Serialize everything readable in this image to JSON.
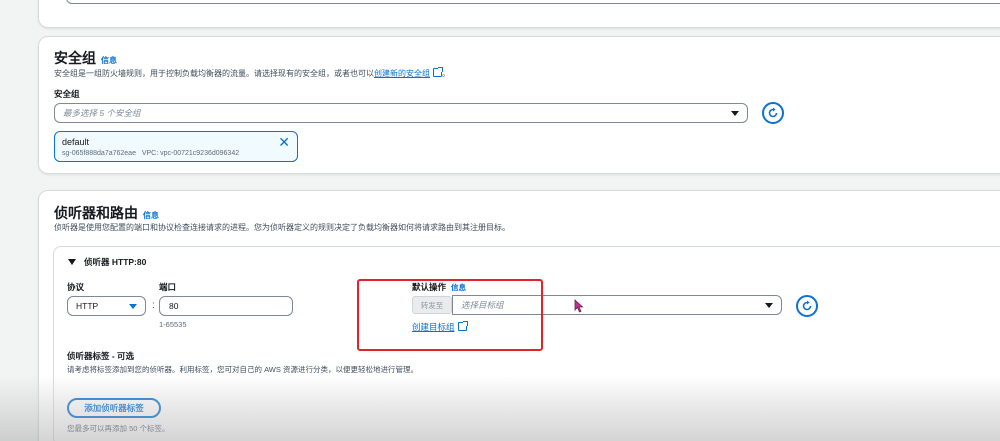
{
  "security_group": {
    "title": "安全组",
    "info": "信息",
    "description": "安全组是一组防火墙规则，用于控制负载均衡器的流量。请选择现有的安全组，或者也可以",
    "create_link": "创建新的安全组",
    "description_end": "。",
    "field_label": "安全组",
    "select_placeholder": "最多选择 5 个安全组",
    "selected": {
      "name": "default",
      "id": "sg-065f888da7a762eae",
      "vpc": "VPC: vpc-00721c9236d096342"
    }
  },
  "listeners": {
    "title": "侦听器和路由",
    "info": "信息",
    "description": "侦听器是使用您配置的端口和协议检查连接请求的进程。您为侦听器定义的规则决定了负载均衡器如何将请求路由到其注册目标。",
    "listener_header": "侦听器 HTTP:80",
    "protocol_label": "协议",
    "protocol_value": "HTTP",
    "colon": ":",
    "port_label": "端口",
    "port_value": "80",
    "port_hint": "1-65535",
    "default_action_label": "默认操作",
    "default_action_info": "信息",
    "forward_to": "转发至",
    "target_placeholder": "选择目标组",
    "create_target_link": "创建目标组",
    "tags_label": "侦听器标签 - 可选",
    "tags_description": "请考虑将标签添加到您的侦听器。利用标签，您可对自己的 AWS 资源进行分类，以便更轻松地进行管理。",
    "add_tag_button": "添加侦听器标签",
    "tags_hint": "您最多可以再添加 50 个标签。"
  },
  "colors": {
    "accent": "#0972d3",
    "highlight": "#e0242a",
    "border": "#7d8998",
    "text": "#16191f"
  }
}
